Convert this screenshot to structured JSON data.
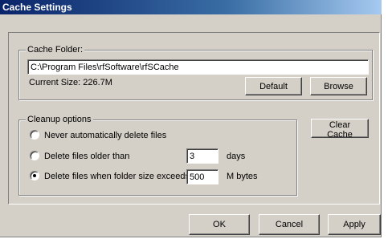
{
  "window": {
    "title": "Cache Settings"
  },
  "cache_folder": {
    "legend": "Cache Folder:",
    "path_value": "C:\\Program Files\\rfSoftware\\rfSCache",
    "current_size_text": "Current Size: 226.7M",
    "default_label": "Default",
    "browse_label": "Browse"
  },
  "cleanup": {
    "legend": "Cleanup options",
    "options": [
      {
        "label": "Never automatically delete files",
        "checked": false
      },
      {
        "label": "Delete files older than",
        "checked": false
      },
      {
        "label": "Delete files when folder size exceeds",
        "checked": true
      }
    ],
    "days_value": "3",
    "days_unit": "days",
    "size_value": "500",
    "size_unit": "M bytes",
    "clear_cache_label": "Clear Cache"
  },
  "footer": {
    "ok_label": "OK",
    "cancel_label": "Cancel",
    "apply_label": "Apply"
  }
}
